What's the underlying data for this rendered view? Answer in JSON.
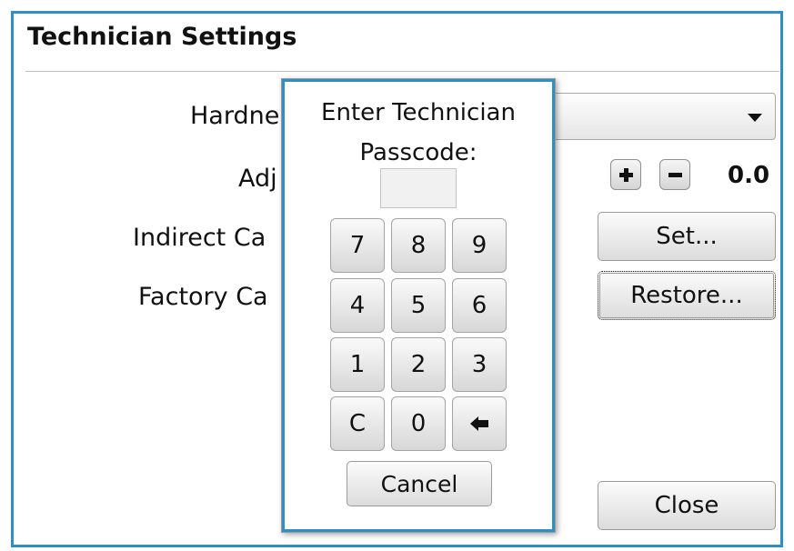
{
  "window": {
    "title": "Technician Settings"
  },
  "labels": {
    "hardness": "Hardne",
    "adjust": "Adj",
    "indirect": "Indirect Ca",
    "factory": "Factory Ca"
  },
  "adjust": {
    "value": "0.0"
  },
  "buttons": {
    "set": "Set...",
    "restore": "Restore...",
    "close": "Close"
  },
  "icons": {
    "plus": "plus-icon",
    "minus": "minus-icon",
    "dropdown": "chevron-down-icon",
    "backspace": "arrow-left-icon"
  },
  "dialog": {
    "title_line1": "Enter Technician",
    "title_line2": "Passcode:",
    "keys": [
      "7",
      "8",
      "9",
      "4",
      "5",
      "6",
      "1",
      "2",
      "3",
      "C",
      "0"
    ],
    "cancel": "Cancel"
  },
  "colors": {
    "accent": "#2f8ec4"
  }
}
